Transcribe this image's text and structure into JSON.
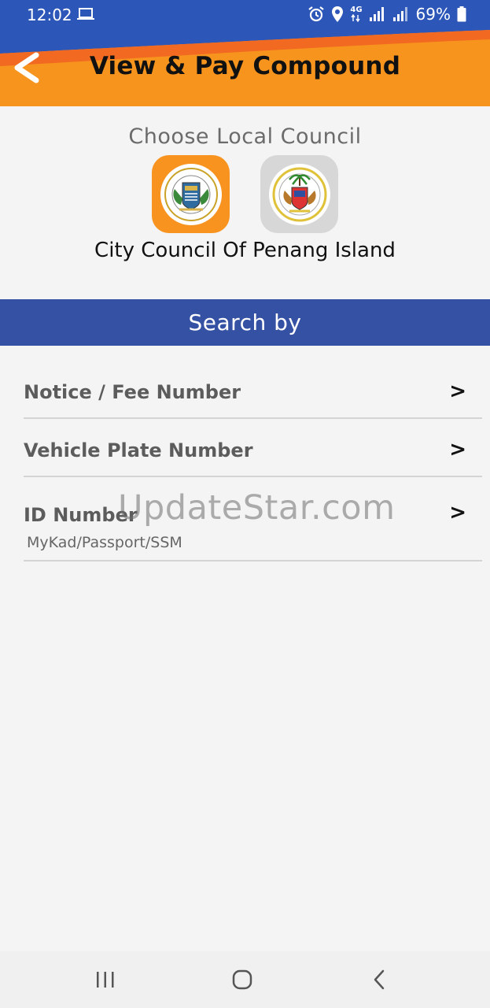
{
  "status_bar": {
    "time": "12:02",
    "network": "4G",
    "battery": "69%"
  },
  "header": {
    "title": "View & Pay Compound",
    "back_icon": "chevron-left-icon"
  },
  "council": {
    "choose_label": "Choose Local Council",
    "selected_name": "City Council Of Penang Island",
    "logos": [
      {
        "id": "penang-island",
        "selected": true,
        "bg": "#f7931e"
      },
      {
        "id": "seberang-perai",
        "selected": false,
        "bg": "#d7d7d7"
      }
    ]
  },
  "search_by": {
    "label": "Search by",
    "bg": "#3551a3"
  },
  "options": [
    {
      "label": "Notice / Fee Number",
      "sublabel": "",
      "chevron": ">"
    },
    {
      "label": "Vehicle Plate Number",
      "sublabel": "",
      "chevron": ">"
    },
    {
      "label": "ID Number",
      "sublabel": "MyKad/Passport/SSM",
      "chevron": ">"
    }
  ],
  "watermark": "UpdateStar.com",
  "colors": {
    "accent_orange": "#f7941d",
    "accent_blue": "#3551a3"
  }
}
